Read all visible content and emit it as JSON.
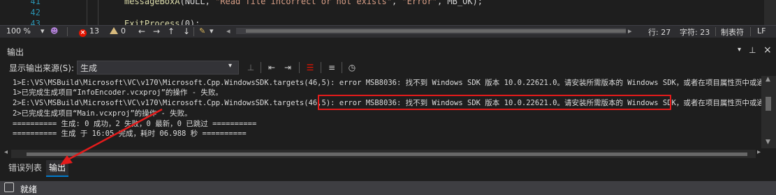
{
  "editor": {
    "lines": [
      {
        "no": "41",
        "text_fn": "messageBoxA",
        "text_rest": "(NULL, ",
        "text_str": "\"Read file incorrect or not exists\"",
        "text_mid": ", ",
        "text_str2": "\"Error\"",
        "text_end": ", MB_OK);"
      },
      {
        "no": "42",
        "text": ""
      },
      {
        "no": "43",
        "text_fn": "ExitProcess",
        "text_rest": "(0);"
      }
    ]
  },
  "editor_status": {
    "zoom": "100 %",
    "errors": "13",
    "warnings": "0",
    "line": "行: 27",
    "char": "字符: 23",
    "indent": "制表符",
    "eol": "LF"
  },
  "output_panel": {
    "title": "输出",
    "source_label": "显示输出来源(S):",
    "source_value": "生成",
    "lines": [
      "1>E:\\VS\\MSBuild\\Microsoft\\VC\\v170\\Microsoft.Cpp.WindowsSDK.targets(46,5): error MSB8036: 找不到 Windows SDK 版本 10.0.22621.0。请安装所需版本的 Windows SDK，或者在项目属性页中或通",
      "1>已完成生成项目“InfoEncoder.vcxproj”的操作 - 失败。",
      "2>E:\\VS\\MSBuild\\Microsoft\\VC\\v170\\Microsoft.Cpp.WindowsSDK.targets(46,5): error MSB8036: 找不到 Windows SDK 版本 10.0.22621.0。请安装所需版本的 Windows SDK，或者在项目属性页中或通",
      "2>已完成生成项目“Main.vcxproj”的操作 - 失败。",
      "========== 生成: 0 成功，2 失败，0 最新，0 已跳过 ==========",
      "========== 生成 于 16:05 完成，耗时 06.988 秒 =========="
    ]
  },
  "tabs": {
    "error_list": "错误列表",
    "output": "输出"
  },
  "status_bar": {
    "text": "就绪"
  },
  "colors": {
    "accent": "#007acc",
    "error": "#e51400",
    "highlight_box": "#e51b1b"
  }
}
